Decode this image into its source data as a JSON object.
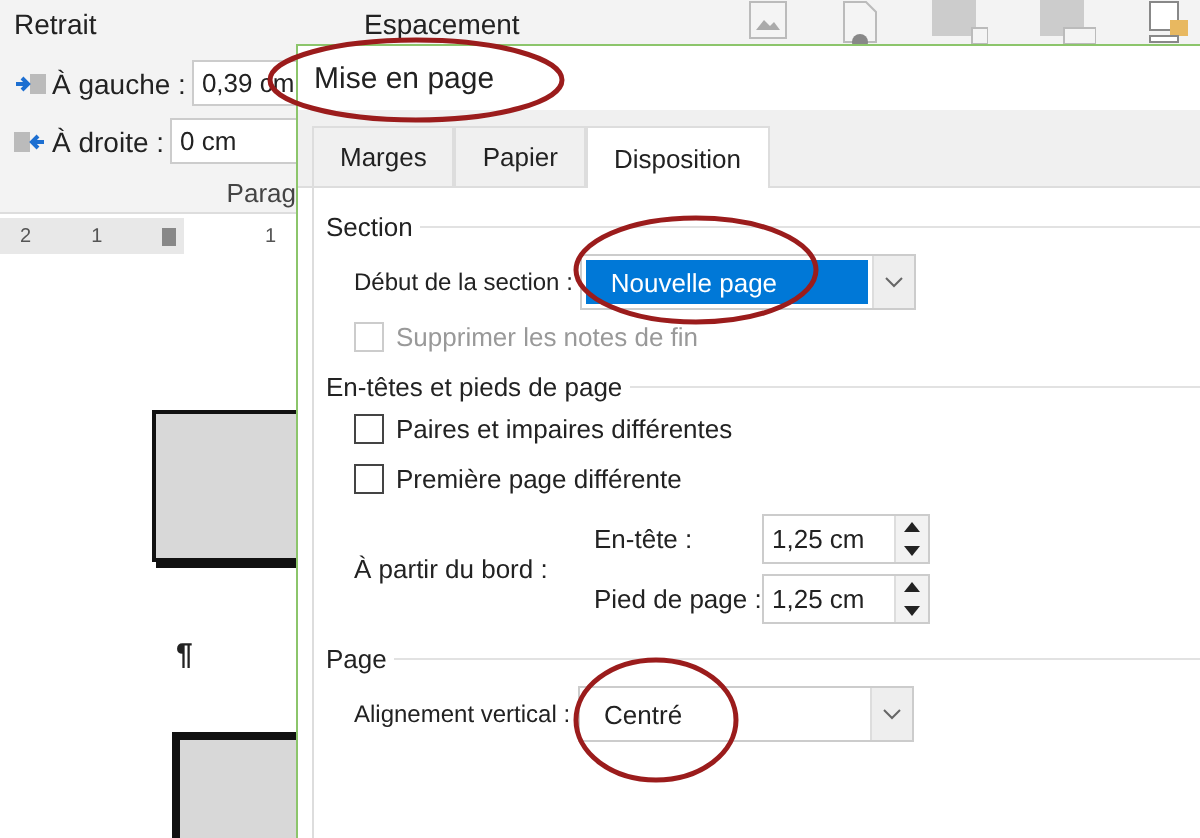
{
  "ribbon": {
    "indent": {
      "title": "Retrait",
      "left": {
        "label": "À gauche :",
        "value": "0,39 cm"
      },
      "right": {
        "label": "À droite :",
        "value": "0 cm"
      }
    },
    "spacing_title": "Espacement",
    "group_label": "Parag"
  },
  "ruler": {
    "labels": [
      "2",
      "1",
      "1"
    ]
  },
  "document": {
    "pilcrow": "¶"
  },
  "dialog": {
    "title": "Mise en page",
    "tabs": [
      {
        "label": "Marges",
        "selected": false
      },
      {
        "label": "Papier",
        "selected": false
      },
      {
        "label": "Disposition",
        "selected": true
      }
    ],
    "section": {
      "title": "Section",
      "start": {
        "label": "Début de la section :",
        "value": "Nouvelle page",
        "focused": true
      },
      "suppress_endnotes": {
        "label": "Supprimer les notes de fin",
        "checked": false,
        "disabled": true
      }
    },
    "headers": {
      "title": "En-têtes et pieds de page",
      "checkboxes": [
        {
          "label": "Paires et impaires différentes",
          "checked": false
        },
        {
          "label": "Première page différente",
          "checked": false
        }
      ],
      "from_edge": {
        "label": "À partir du bord :",
        "fields": [
          {
            "label": "En-tête :",
            "value": "1,25 cm"
          },
          {
            "label": "Pied de page :",
            "value": "1,25 cm"
          }
        ]
      }
    },
    "page": {
      "title": "Page",
      "vertical_alignment": {
        "label": "Alignement vertical :",
        "value": "Centré"
      }
    }
  }
}
